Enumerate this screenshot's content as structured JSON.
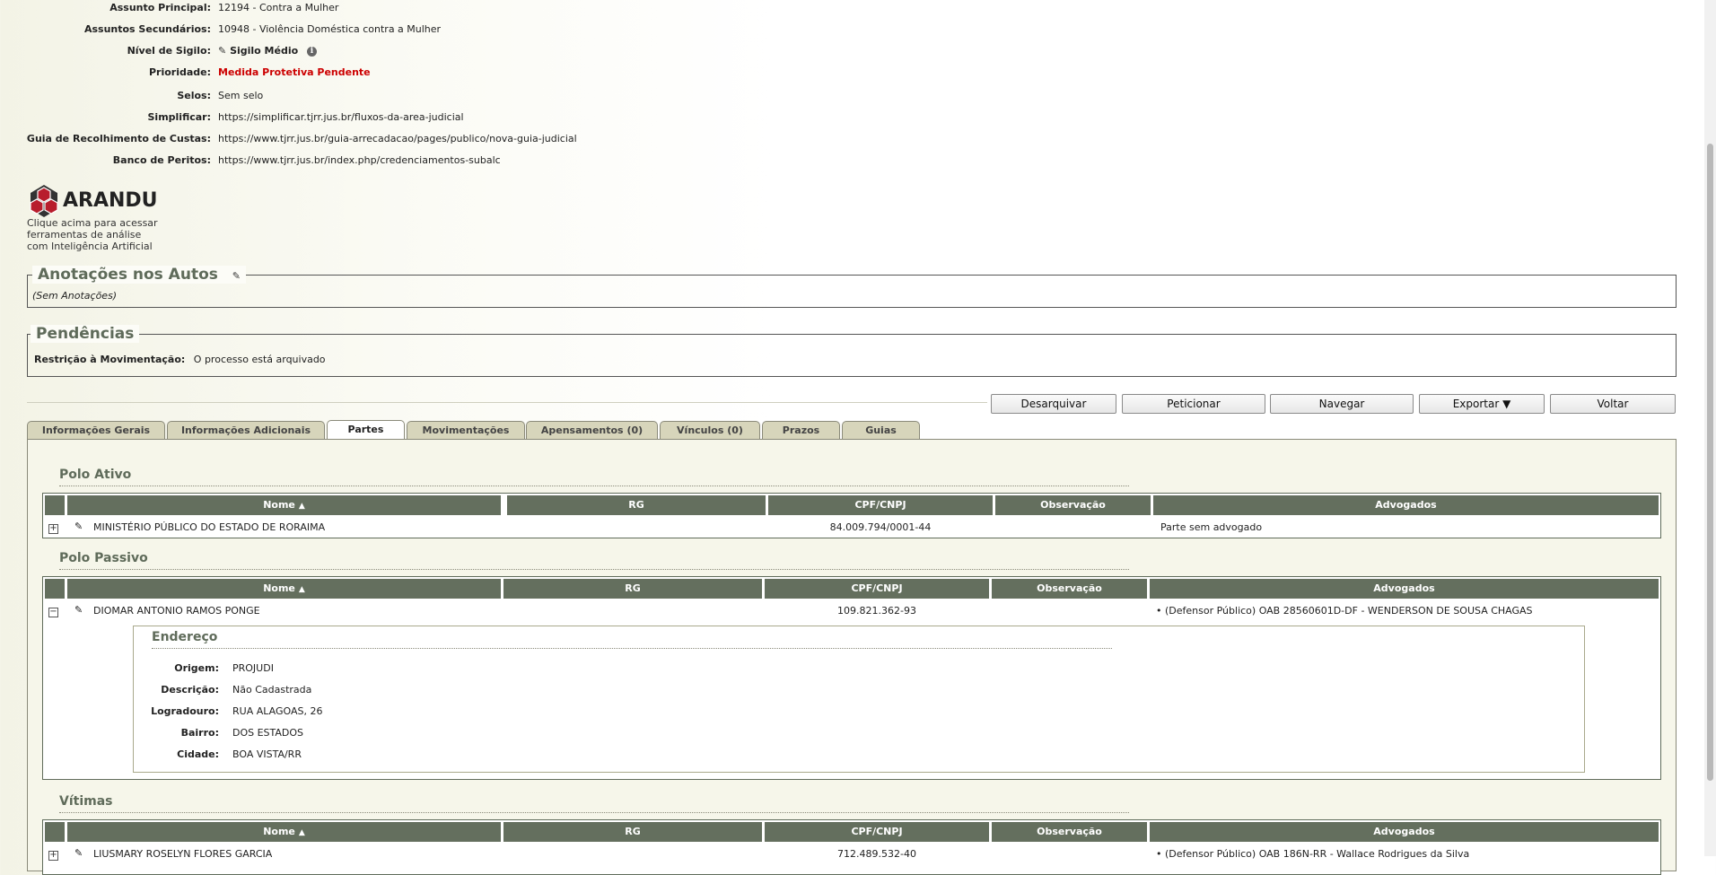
{
  "info": [
    {
      "label": "Assunto Principal:",
      "value": "12194 - Contra a Mulher"
    },
    {
      "label": "Assuntos Secundários:",
      "value": "10948 - Violência Doméstica contra a Mulher"
    },
    {
      "label": "Nível de Sigilo:",
      "value": "Sigilo Médio"
    },
    {
      "label": "Prioridade:",
      "value": "Medida Protetiva Pendente"
    },
    {
      "label": "Selos:",
      "value": "Sem selo"
    },
    {
      "label": "Simplificar:",
      "value": "https://simplificar.tjrr.jus.br/fluxos-da-area-judicial"
    },
    {
      "label": "Guia de Recolhimento de Custas:",
      "value": "https://www.tjrr.jus.br/guia-arrecadacao/pages/publico/nova-guia-judicial"
    },
    {
      "label": "Banco de Peritos:",
      "value": "https://www.tjrr.jus.br/index.php/credenciamentos-subalc"
    }
  ],
  "logo": {
    "name": "ARANDU",
    "caption_lines": [
      "Clique acima para acessar",
      "ferramentas de análise",
      "com Inteligência Artificial"
    ]
  },
  "anotacoes": {
    "title": "Anotações nos Autos",
    "empty": "(Sem Anotações)"
  },
  "pendencias": {
    "title": "Pendências",
    "label": "Restrição à Movimentação:",
    "value": "O processo está arquivado"
  },
  "buttons": [
    "Desarquivar",
    "Peticionar",
    "Navegar",
    "Exportar ▼",
    "Voltar"
  ],
  "tabs": [
    "Informações Gerais",
    "Informações Adicionais",
    "Partes",
    "Movimentações",
    "Apensamentos (0)",
    "Vínculos (0)",
    "Prazos",
    "Guias"
  ],
  "active_tab": "Partes",
  "columns": [
    "Nome",
    "RG",
    "CPF/CNPJ",
    "Observação",
    "Advogados"
  ],
  "polo_ativo": {
    "title": "Polo Ativo",
    "rows": [
      {
        "nome": "MINISTÉRIO PÚBLICO DO ESTADO DE RORAIMA",
        "rg": "",
        "cpf": "84.009.794/0001-44",
        "obs": "",
        "adv": "Parte sem advogado"
      }
    ]
  },
  "polo_passivo": {
    "title": "Polo Passivo",
    "rows": [
      {
        "nome": "DIOMAR ANTONIO RAMOS PONGE",
        "rg": "",
        "cpf": "109.821.362-93",
        "obs": "",
        "adv": "(Defensor Público) OAB 28560601D-DF - WENDERSON DE SOUSA CHAGAS"
      }
    ],
    "endereco": {
      "title": "Endereço",
      "fields": [
        {
          "label": "Origem:",
          "value": "PROJUDI"
        },
        {
          "label": "Descrição:",
          "value": "Não Cadastrada"
        },
        {
          "label": "Logradouro:",
          "value": "RUA ALAGOAS, 26"
        },
        {
          "label": "Bairro:",
          "value": "DOS ESTADOS"
        },
        {
          "label": "Cidade:",
          "value": "BOA VISTA/RR"
        }
      ]
    }
  },
  "vitimas": {
    "title": "Vítimas",
    "rows": [
      {
        "nome": "LIUSMARY ROSELYN FLORES GARCIA",
        "rg": "",
        "cpf": "712.489.532-40",
        "obs": "",
        "adv": "(Defensor Público) OAB 186N-RR - Wallace Rodrigues da Silva"
      }
    ]
  },
  "icons": {
    "edit": "pencil-icon",
    "info": "info-icon",
    "expand": "plus-box-icon",
    "collapse": "minus-box-icon",
    "sort": "sort-ascending-icon"
  },
  "colors": {
    "priority": "#cc0000",
    "header_bg": "#646f5e",
    "section_title": "#5f6b5a"
  }
}
